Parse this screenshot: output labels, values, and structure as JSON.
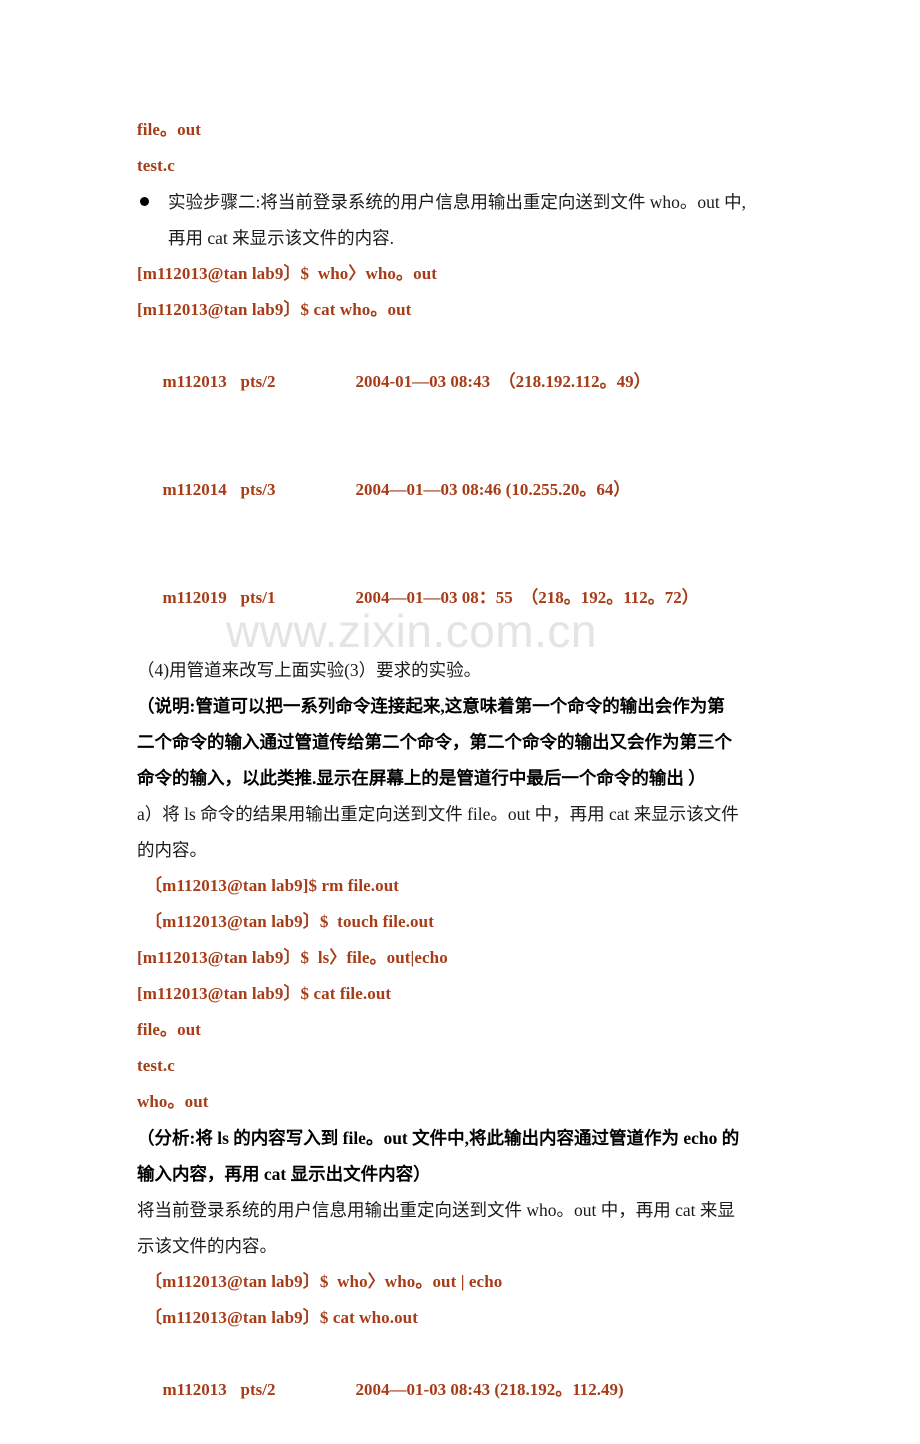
{
  "document": {
    "watermark": "www.zixin.com.cn",
    "colors": {
      "terminal_text": "#a63c18",
      "body_text": "#1a1a1a",
      "emphasis_text": "#000000",
      "watermark": "#e4e4e4",
      "page_background": "#ffffff"
    }
  },
  "blocks": {
    "out1_file": "file。out",
    "out1_test": "test.c",
    "step_two": {
      "line1": "实验步骤二:将当前登录系统的用户信息用输出重定向送到文件 who。out 中,",
      "line2": "再用 cat 来显示该文件的内容."
    },
    "cmd_who_redirect": "[m112013@tan lab9〕$  who〉who。out",
    "cmd_cat_who": "[m112013@tan lab9〕$ cat who。out",
    "who_rows": [
      {
        "user": "m112013",
        "tty": "pts/2",
        "rest": "2004-01—03 08:43  （218.192.112。49）"
      },
      {
        "user": "m112014",
        "tty": "pts/3",
        "rest": "2004—01—03 08:46 (10.255.20。64）"
      },
      {
        "user": "m112019",
        "tty": "pts/1",
        "rest": "2004—01—03 08：55  （218。192。112。72）"
      }
    ],
    "item4": "（4)用管道来改写上面实验(3）要求的实验。",
    "explain": {
      "line1": "（说明:管道可以把一系列命令连接起来,这意味着第一个命令的输出会作为第",
      "line2": "二个命令的输入通过管道传给第二个命令，第二个命令的输出又会作为第三个",
      "line3": "命令的输入，以此类推.显示在屏幕上的是管道行中最后一个命令的输出 ）"
    },
    "item_a": {
      "line1": "a）将 ls 命令的结果用输出重定向送到文件 file。out 中，再用 cat 来显示该文件",
      "line2": "的内容。"
    },
    "cmd_rm_file": "〔m112013@tan lab9]$ rm file.out",
    "cmd_touch_file": "〔m112013@tan lab9〕$  touch file.out",
    "cmd_ls_pipe": "[m112013@tan lab9〕$  ls〉file。out|echo",
    "cmd_cat_file": "[m112013@tan lab9〕$ cat file.out",
    "out2_file": "file。out",
    "out2_test": "test.c",
    "out2_who": "who。out",
    "analysis": {
      "line1": "（分析:将 ls 的内容写入到 file。out 文件中,将此输出内容通过管道作为 echo 的",
      "line2": "输入内容，再用 cat 显示出文件内容）"
    },
    "who_desc": {
      "line1": "将当前登录系统的用户信息用输出重定向送到文件 who。out 中，再用 cat 来显",
      "line2": "示该文件的内容。"
    },
    "cmd_who_pipe": "〔m112013@tan lab9〕$  who〉who。out | echo",
    "cmd_cat_who2": "〔m112013@tan lab9〕$ cat who.out",
    "who_row_final": {
      "user": "m112013",
      "tty": "pts/2",
      "rest": "2004—01-03 08:43 (218.192。112.49)"
    }
  }
}
